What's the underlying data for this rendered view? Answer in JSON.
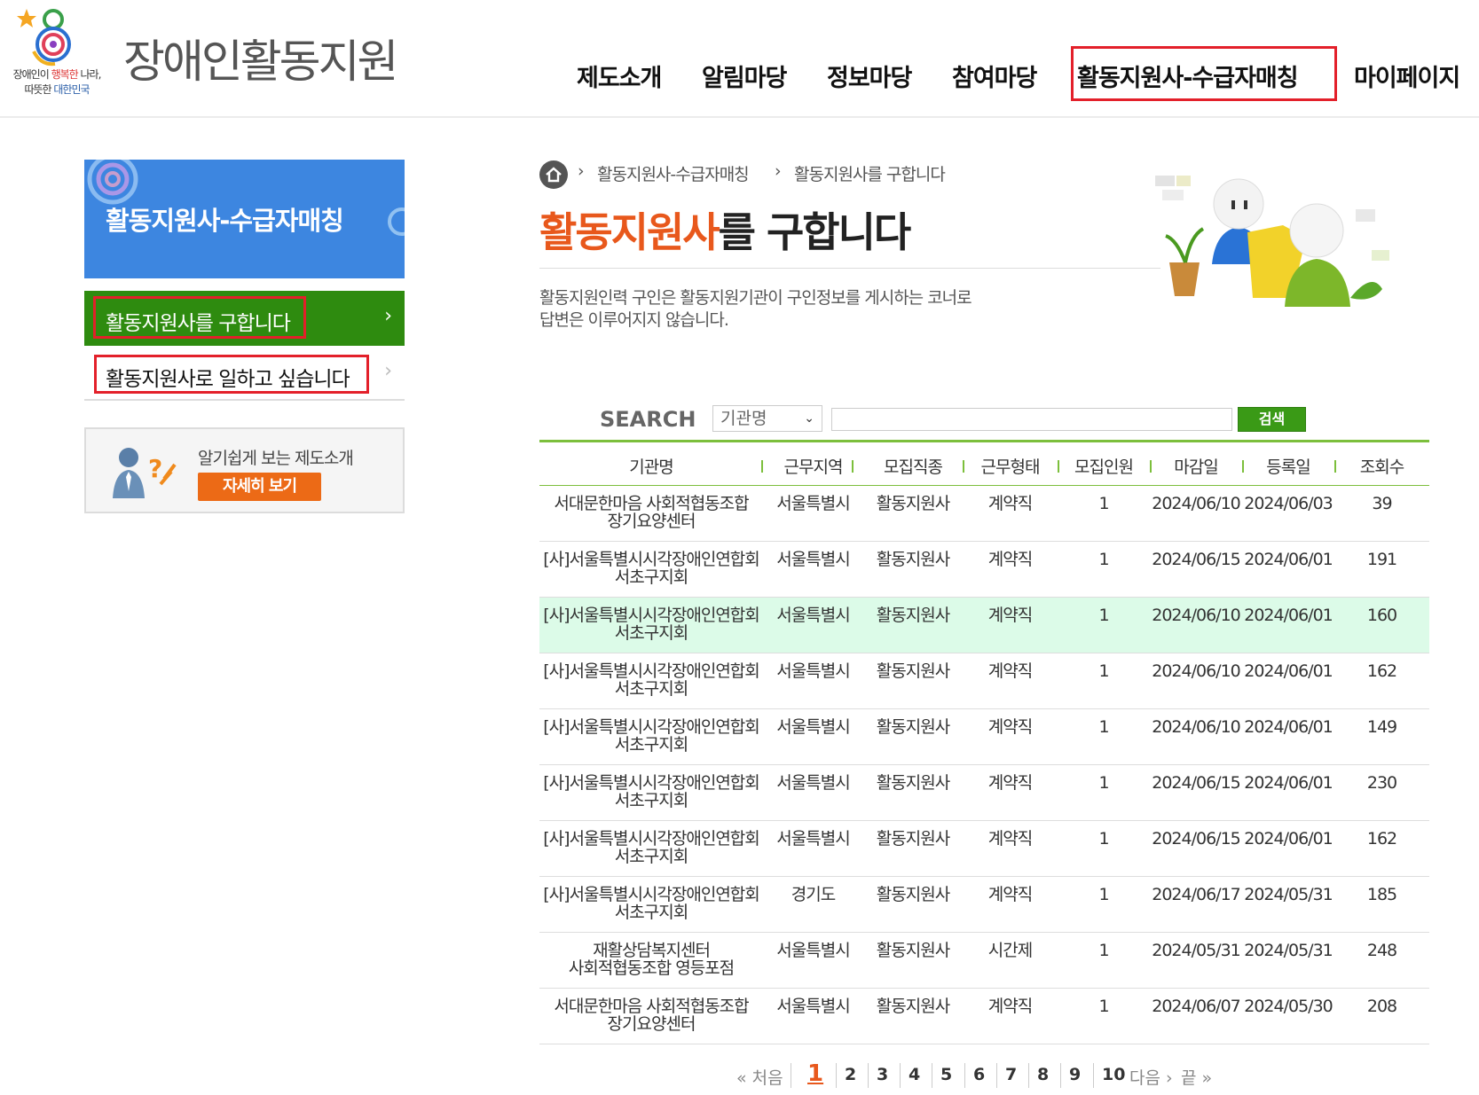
{
  "header": {
    "slogan_prefix": "장애인이 ",
    "slogan_red": "행복한",
    "slogan_mid": " 나라,",
    "slogan_line2_prefix": "따뜻한 ",
    "slogan_blue": "대한민국",
    "site_title": "장애인활동지원",
    "nav": [
      "제도소개",
      "알림마당",
      "정보마당",
      "참여마당",
      "활동지원사-수급자매칭",
      "마이페이지"
    ]
  },
  "sidebar": {
    "title": "활동지원사-수급자매칭",
    "items": [
      {
        "label": "활동지원사를 구합니다",
        "active": true
      },
      {
        "label": "활동지원사로 일하고 싶습니다",
        "active": false
      }
    ],
    "guide_text": "알기쉽게 보는 제도소개",
    "guide_button": "자세히 보기"
  },
  "breadcrumb": [
    "활동지원사-수급자매칭",
    "활동지원사를 구합니다"
  ],
  "page_title_highlight": "활동지원사",
  "page_title_rest": "를 구합니다",
  "description": [
    "활동지원인력 구인은 활동지원기관이 구인정보를 게시하는 코너로",
    "답변은 이루어지지 않습니다."
  ],
  "search": {
    "label": "SEARCH",
    "select_value": "기관명",
    "input_value": "",
    "button": "검색"
  },
  "table": {
    "columns": [
      "기관명",
      "근무지역",
      "모집직종",
      "근무형태",
      "모집인원",
      "마감일",
      "등록일",
      "조회수"
    ],
    "rows": [
      {
        "org": "서대문한마음 사회적협동조합 장기요양센터",
        "region": "서울특별시",
        "job": "활동지원사",
        "type": "계약직",
        "count": "1",
        "deadline": "2024/06/10",
        "registered": "2024/06/03",
        "views": "39"
      },
      {
        "org": "[사]서울특별시시각장애인연합회 서초구지회",
        "region": "서울특별시",
        "job": "활동지원사",
        "type": "계약직",
        "count": "1",
        "deadline": "2024/06/15",
        "registered": "2024/06/01",
        "views": "191"
      },
      {
        "org": "[사]서울특별시시각장애인연합회 서초구지회",
        "region": "서울특별시",
        "job": "활동지원사",
        "type": "계약직",
        "count": "1",
        "deadline": "2024/06/10",
        "registered": "2024/06/01",
        "views": "160"
      },
      {
        "org": "[사]서울특별시시각장애인연합회 서초구지회",
        "region": "서울특별시",
        "job": "활동지원사",
        "type": "계약직",
        "count": "1",
        "deadline": "2024/06/10",
        "registered": "2024/06/01",
        "views": "162"
      },
      {
        "org": "[사]서울특별시시각장애인연합회 서초구지회",
        "region": "서울특별시",
        "job": "활동지원사",
        "type": "계약직",
        "count": "1",
        "deadline": "2024/06/10",
        "registered": "2024/06/01",
        "views": "149"
      },
      {
        "org": "[사]서울특별시시각장애인연합회 서초구지회",
        "region": "서울특별시",
        "job": "활동지원사",
        "type": "계약직",
        "count": "1",
        "deadline": "2024/06/15",
        "registered": "2024/06/01",
        "views": "230"
      },
      {
        "org": "[사]서울특별시시각장애인연합회 서초구지회",
        "region": "서울특별시",
        "job": "활동지원사",
        "type": "계약직",
        "count": "1",
        "deadline": "2024/06/15",
        "registered": "2024/06/01",
        "views": "162"
      },
      {
        "org": "[사]서울특별시시각장애인연합회 서초구지회",
        "region": "경기도",
        "job": "활동지원사",
        "type": "계약직",
        "count": "1",
        "deadline": "2024/06/17",
        "registered": "2024/05/31",
        "views": "185"
      },
      {
        "org": "재활상담복지센터 사회적협동조합 영등포점",
        "region": "서울특별시",
        "job": "활동지원사",
        "type": "시간제",
        "count": "1",
        "deadline": "2024/05/31",
        "registered": "2024/05/31",
        "views": "248"
      },
      {
        "org": "서대문한마음 사회적협동조합 장기요양센터",
        "region": "서울특별시",
        "job": "활동지원사",
        "type": "계약직",
        "count": "1",
        "deadline": "2024/06/07",
        "registered": "2024/05/30",
        "views": "208"
      }
    ]
  },
  "pagination": {
    "first": "처음",
    "pages": [
      "1",
      "2",
      "3",
      "4",
      "5",
      "6",
      "7",
      "8",
      "9",
      "10"
    ],
    "current": "1",
    "next": "다음",
    "last": "끝"
  }
}
